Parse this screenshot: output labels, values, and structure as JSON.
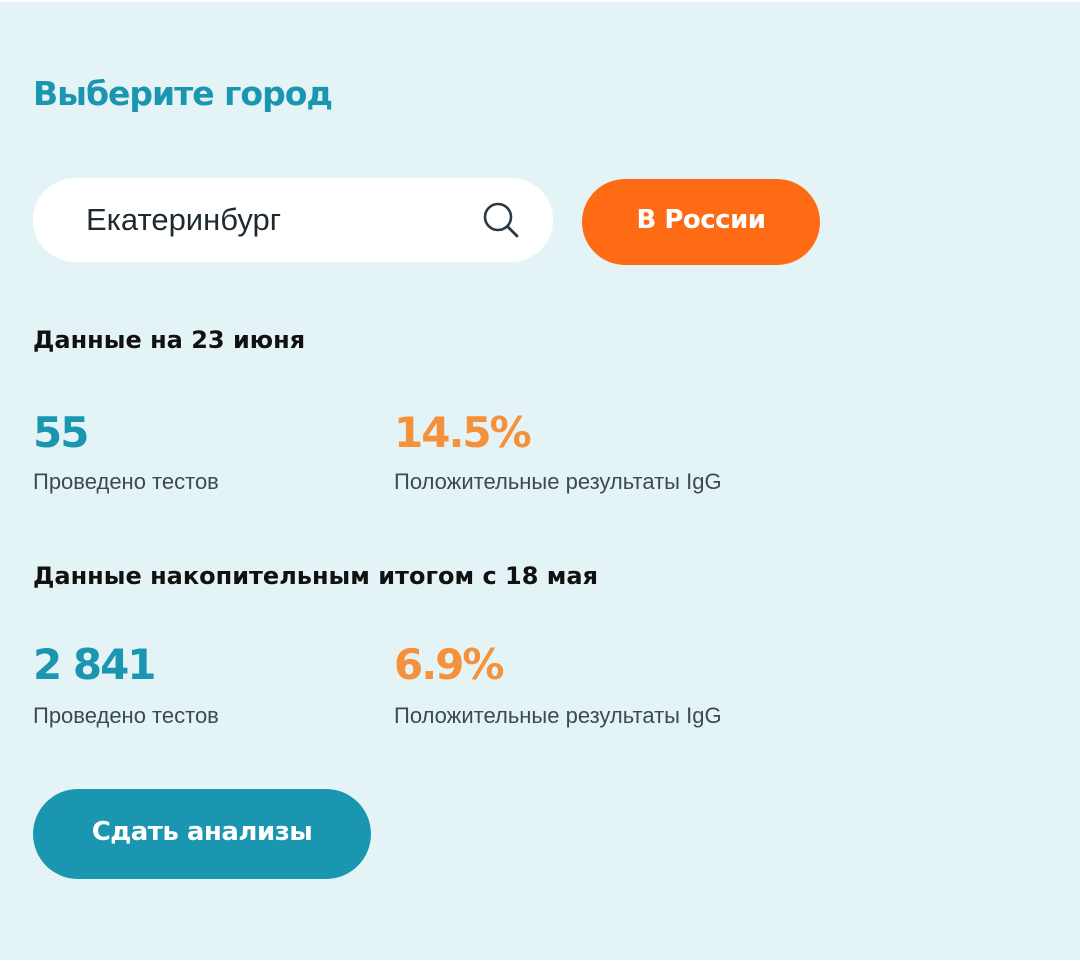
{
  "header": {
    "title": "Выберите город"
  },
  "search": {
    "value": "Екатеринбург",
    "icon": "search-icon"
  },
  "region_button": {
    "label": "В России"
  },
  "daily": {
    "heading": "Данные на 23 июня",
    "tests_value": "55",
    "tests_label": "Проведено тестов",
    "positive_value": "14.5%",
    "positive_label": "Положительные результаты IgG"
  },
  "cumulative": {
    "heading": "Данные накопительным итогом с 18 мая",
    "tests_value": "2 841",
    "tests_label": "Проведено тестов",
    "positive_value": "6.9%",
    "positive_label": "Положительные результаты IgG"
  },
  "cta": {
    "label": "Сдать анализы"
  },
  "colors": {
    "accent_blue": "#1a96b0",
    "accent_orange": "#ff6a14",
    "stat_orange": "#f5913a",
    "background": "#e4f4f6"
  }
}
